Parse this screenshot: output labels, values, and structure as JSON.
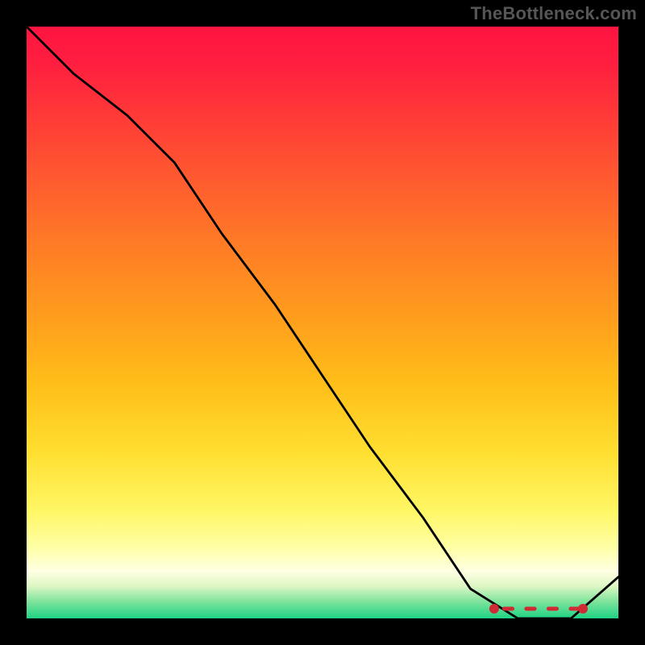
{
  "attribution": "TheBottleneck.com",
  "chart_data": {
    "type": "line",
    "title": "",
    "xlabel": "",
    "ylabel": "",
    "xlim": [
      0,
      100
    ],
    "ylim": [
      0,
      100
    ],
    "x": [
      0,
      8,
      17,
      25,
      33,
      42,
      50,
      58,
      67,
      75,
      83,
      92,
      100
    ],
    "values": [
      100,
      92,
      85,
      77,
      65,
      53,
      41,
      29,
      17,
      5,
      0,
      0,
      7
    ],
    "optimum_band": {
      "x_start": 79,
      "x_end": 94,
      "y": 0
    },
    "background_gradient": {
      "top_color": "#ff1440",
      "mid_color": "#ffe040",
      "bottom_color": "#1ed384"
    }
  },
  "colors": {
    "frame": "#000000",
    "line": "#000000",
    "markers": "#d02a34",
    "attribution_text": "#565656"
  }
}
